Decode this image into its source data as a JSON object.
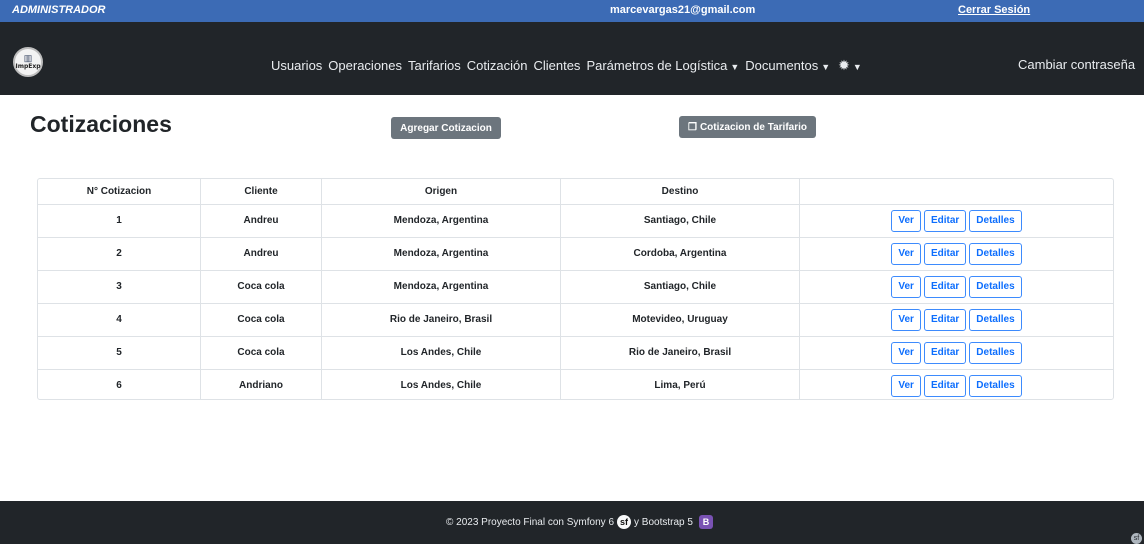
{
  "topbar": {
    "role": "ADMINISTRADOR",
    "email": "marcevargas21@gmail.com",
    "logout": "Cerrar Sesión"
  },
  "navbar": {
    "logo_text": "ImpExp",
    "items": [
      "Usuarios",
      "Operaciones",
      "Tarifarios",
      "Cotización",
      "Clientes",
      "Parámetros de Logística",
      "Documentos"
    ],
    "change_password": "Cambiar contraseña"
  },
  "main": {
    "title": "Cotizaciones",
    "add_button": "Agregar Cotizacion",
    "tariff_button": "Cotizacion de Tarifario"
  },
  "table": {
    "headers": [
      "N° Cotizacion",
      "Cliente",
      "Origen",
      "Destino",
      ""
    ],
    "rows": [
      [
        "1",
        "Andreu",
        "Mendoza, Argentina",
        "Santiago, Chile"
      ],
      [
        "2",
        "Andreu",
        "Mendoza, Argentina",
        "Cordoba, Argentina"
      ],
      [
        "3",
        "Coca cola",
        "Mendoza, Argentina",
        "Santiago, Chile"
      ],
      [
        "4",
        "Coca cola",
        "Rio de Janeiro, Brasil",
        "Motevideo, Uruguay"
      ],
      [
        "5",
        "Coca cola",
        "Los Andes, Chile",
        "Rio de Janeiro, Brasil"
      ],
      [
        "6",
        "Andriano",
        "Los Andes, Chile",
        "Lima, Perú"
      ]
    ],
    "actions": [
      "Ver",
      "Editar",
      "Detalles"
    ]
  },
  "footer": {
    "text_before": "© 2023 Proyecto Final con Symfony 6",
    "text_after": "y Bootstrap 5"
  },
  "icons": [
    "logo",
    "caret-down-icon",
    "gear-icon",
    "copy-icon",
    "symfony-icon",
    "bootstrap-icon"
  ],
  "colors": {
    "topbar": "#3c6bb5",
    "navbar": "#212529",
    "secondary_button": "#6c757d",
    "outline_primary": "#0d6efd"
  }
}
